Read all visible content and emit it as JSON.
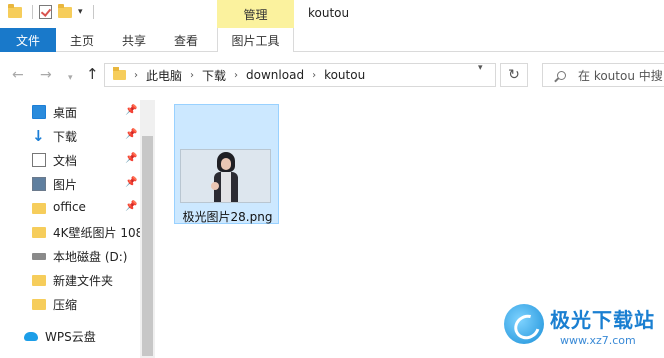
{
  "window": {
    "title": "koutou",
    "context_group": "管理"
  },
  "quick_access_toolbar": {
    "icons": [
      "folder-icon",
      "properties-check-icon",
      "new-folder-icon",
      "customize-dropdown-icon"
    ]
  },
  "ribbon": {
    "tabs": [
      {
        "label": "文件",
        "active": false,
        "accent": "#1979ca"
      },
      {
        "label": "主页"
      },
      {
        "label": "共享"
      },
      {
        "label": "查看"
      },
      {
        "label": "图片工具",
        "active": true
      }
    ]
  },
  "navigation": {
    "back_icon": "arrow-left-icon",
    "forward_icon": "arrow-right-icon",
    "recent_icon": "chevron-down-icon",
    "up_icon": "arrow-up-icon",
    "breadcrumb": [
      "此电脑",
      "下载",
      "download",
      "koutou"
    ],
    "refresh_icon": "refresh-icon",
    "search_placeholder": "在 koutou 中搜"
  },
  "sidebar": {
    "items": [
      {
        "label": "桌面",
        "icon": "desktop-icon",
        "pinned": true
      },
      {
        "label": "下载",
        "icon": "download-icon",
        "pinned": true
      },
      {
        "label": "文档",
        "icon": "document-icon",
        "pinned": true
      },
      {
        "label": "图片",
        "icon": "pictures-icon",
        "pinned": true
      },
      {
        "label": "office",
        "icon": "folder-icon",
        "pinned": true
      },
      {
        "label": "4K壁纸图片 108",
        "icon": "folder-icon",
        "pinned": false
      },
      {
        "label": "本地磁盘 (D:)",
        "icon": "drive-icon",
        "pinned": false
      },
      {
        "label": "新建文件夹",
        "icon": "folder-icon",
        "pinned": false
      },
      {
        "label": "压缩",
        "icon": "folder-icon",
        "pinned": false
      },
      {
        "label": "WPS云盘",
        "icon": "cloud-icon",
        "pinned": false
      }
    ]
  },
  "content": {
    "files": [
      {
        "name": "极光图片28.png",
        "selected": true
      }
    ]
  },
  "watermark": {
    "title": "极光下载站",
    "url": "www.xz7.com"
  },
  "colors": {
    "accent": "#1979ca",
    "selection_bg": "#cce8ff",
    "selection_border": "#99d1ff",
    "context_group": "#fbf29e"
  }
}
